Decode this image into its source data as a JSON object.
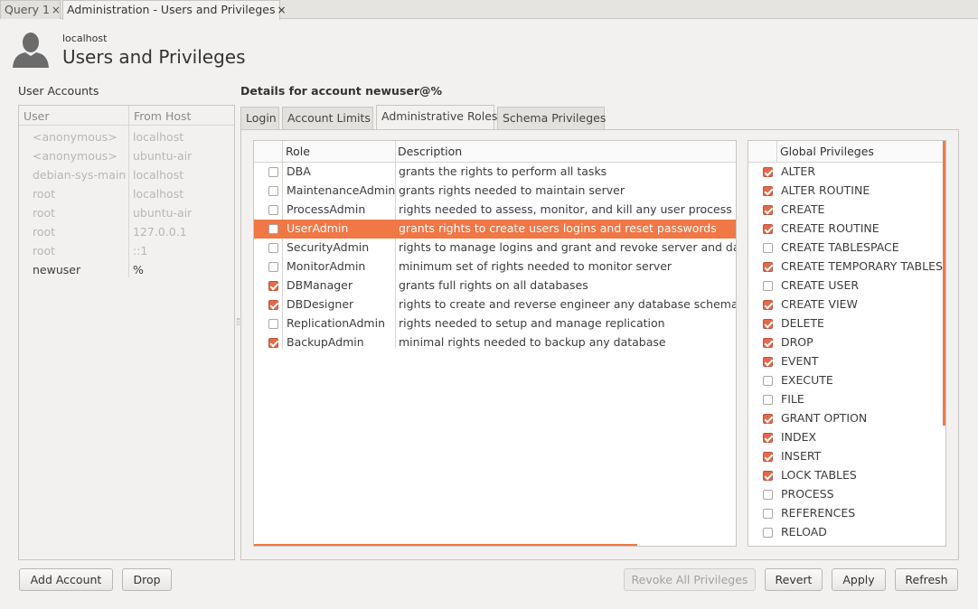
{
  "tabs": [
    {
      "label": "Query 1",
      "close": "×"
    },
    {
      "label": "Administration - Users and Privileges",
      "close": "×"
    }
  ],
  "header": {
    "host": "localhost",
    "title": "Users and Privileges"
  },
  "accounts": {
    "heading": "User Accounts",
    "columns": [
      "User",
      "From Host"
    ],
    "rows": [
      {
        "user": "<anonymous>",
        "host": "localhost",
        "muted": true
      },
      {
        "user": "<anonymous>",
        "host": "ubuntu-air",
        "muted": true
      },
      {
        "user": "debian-sys-maint",
        "host": "localhost",
        "muted": true
      },
      {
        "user": "root",
        "host": "localhost",
        "muted": true
      },
      {
        "user": "root",
        "host": "ubuntu-air",
        "muted": true
      },
      {
        "user": "root",
        "host": "127.0.0.1",
        "muted": true
      },
      {
        "user": "root",
        "host": "::1",
        "muted": true
      },
      {
        "user": "newuser",
        "host": "%",
        "muted": false
      }
    ]
  },
  "details": {
    "heading": "Details for account newuser@%",
    "tabs": [
      "Login",
      "Account Limits",
      "Administrative Roles",
      "Schema Privileges"
    ],
    "active_tab": "Administrative Roles"
  },
  "roles": {
    "columns": [
      "Role",
      "Description"
    ],
    "rows": [
      {
        "role": "DBA",
        "desc": "grants the rights to perform all tasks",
        "checked": false,
        "selected": false
      },
      {
        "role": "MaintenanceAdmin",
        "desc": "grants rights needed to maintain server",
        "checked": false,
        "selected": false
      },
      {
        "role": "ProcessAdmin",
        "desc": "rights needed to assess, monitor, and kill any user process running in server",
        "checked": false,
        "selected": false
      },
      {
        "role": "UserAdmin",
        "desc": "grants rights to create users logins and reset passwords",
        "checked": false,
        "selected": true
      },
      {
        "role": "SecurityAdmin",
        "desc": "rights to manage logins and grant and revoke server and database level permission",
        "checked": false,
        "selected": false
      },
      {
        "role": "MonitorAdmin",
        "desc": "minimum set of rights needed to monitor server",
        "checked": false,
        "selected": false
      },
      {
        "role": "DBManager",
        "desc": "grants full rights on all databases",
        "checked": true,
        "selected": false
      },
      {
        "role": "DBDesigner",
        "desc": "rights to create and reverse engineer any database schema",
        "checked": true,
        "selected": false
      },
      {
        "role": "ReplicationAdmin",
        "desc": "rights needed to setup and manage replication",
        "checked": false,
        "selected": false
      },
      {
        "role": "BackupAdmin",
        "desc": "minimal rights needed to backup any database",
        "checked": true,
        "selected": false
      }
    ]
  },
  "privileges": {
    "column": "Global Privileges",
    "rows": [
      {
        "name": "ALTER",
        "checked": true
      },
      {
        "name": "ALTER ROUTINE",
        "checked": true
      },
      {
        "name": "CREATE",
        "checked": true
      },
      {
        "name": "CREATE ROUTINE",
        "checked": true
      },
      {
        "name": "CREATE TABLESPACE",
        "checked": false
      },
      {
        "name": "CREATE TEMPORARY TABLES",
        "checked": true
      },
      {
        "name": "CREATE USER",
        "checked": false
      },
      {
        "name": "CREATE VIEW",
        "checked": true
      },
      {
        "name": "DELETE",
        "checked": true
      },
      {
        "name": "DROP",
        "checked": true
      },
      {
        "name": "EVENT",
        "checked": true
      },
      {
        "name": "EXECUTE",
        "checked": false
      },
      {
        "name": "FILE",
        "checked": false
      },
      {
        "name": "GRANT OPTION",
        "checked": true
      },
      {
        "name": "INDEX",
        "checked": true
      },
      {
        "name": "INSERT",
        "checked": true
      },
      {
        "name": "LOCK TABLES",
        "checked": true
      },
      {
        "name": "PROCESS",
        "checked": false
      },
      {
        "name": "REFERENCES",
        "checked": false
      },
      {
        "name": "RELOAD",
        "checked": false
      }
    ]
  },
  "buttons": {
    "add_account": "Add Account",
    "drop": "Drop",
    "revoke_all": "Revoke All Privileges",
    "revert": "Revert",
    "apply": "Apply",
    "refresh": "Refresh"
  },
  "colors": {
    "accent": "#f07746",
    "check": "#e4684a"
  }
}
